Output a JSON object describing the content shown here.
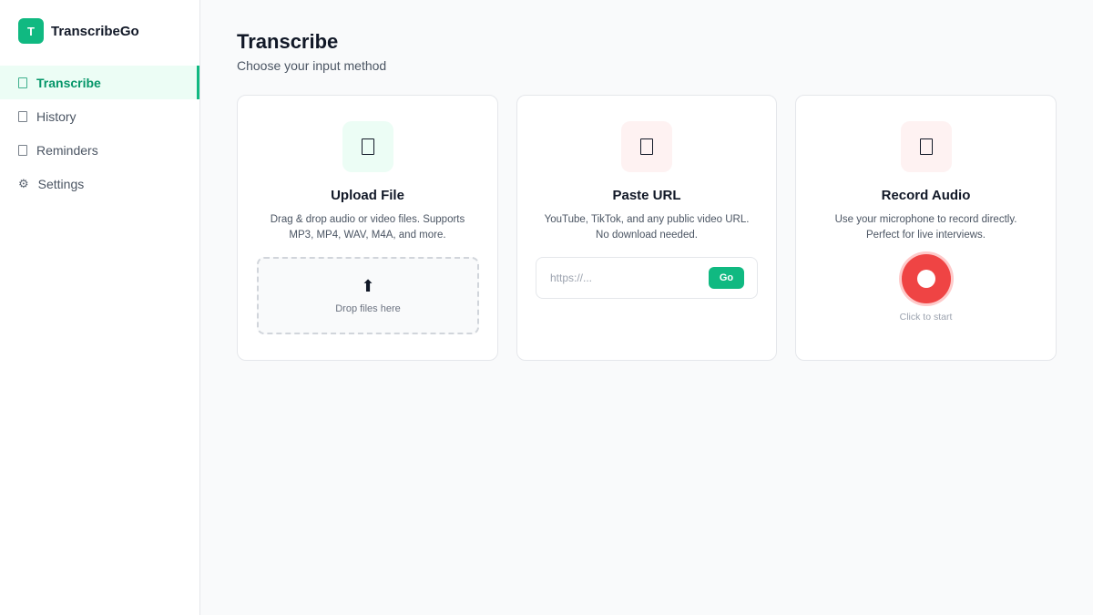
{
  "app": {
    "logo_letter": "T",
    "name": "TranscribeGo"
  },
  "sidebar": {
    "items": [
      {
        "label": "Transcribe",
        "icon": "document-icon",
        "active": true
      },
      {
        "label": "History",
        "icon": "document-icon",
        "active": false
      },
      {
        "label": "Reminders",
        "icon": "document-icon",
        "active": false
      },
      {
        "label": "Settings",
        "icon": "gear-icon",
        "active": false
      }
    ]
  },
  "main": {
    "title": "Transcribe",
    "subtitle": "Choose your input method",
    "cards": {
      "upload": {
        "title": "Upload File",
        "description": "Drag & drop audio or video files. Supports MP3, MP4, WAV, M4A, and more.",
        "drop_icon": "⬆",
        "drop_label": "Drop files here"
      },
      "url": {
        "title": "Paste URL",
        "description": "YouTube, TikTok, and any public video URL. No download needed.",
        "input_placeholder": "https://...",
        "go_label": "Go"
      },
      "record": {
        "title": "Record Audio",
        "description": "Use your microphone to record directly. Perfect for live interviews.",
        "hint": "Click to start"
      }
    }
  },
  "colors": {
    "accent": "#10b981",
    "record": "#ef4444",
    "upload_icon_bg": "#ecfdf5",
    "url_icon_bg": "#fef2f2",
    "record_icon_bg": "#fef2f2"
  }
}
